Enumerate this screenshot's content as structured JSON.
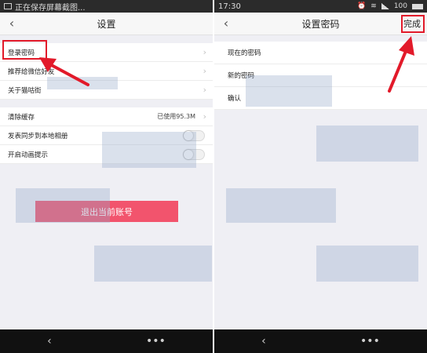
{
  "left_screen": {
    "status": {
      "notice": "正在保存屏幕截图..."
    },
    "title": "设置",
    "rows": [
      {
        "label": "登录密码",
        "value": ""
      },
      {
        "label": "推荐给微信好友",
        "value": ""
      },
      {
        "label": "关于猫咕街",
        "value": ""
      }
    ],
    "rows2": [
      {
        "label": "清除缓存",
        "value": "已使用95.3M"
      },
      {
        "label": "发表同步到本地相册",
        "value": ""
      },
      {
        "label": "开启动画提示",
        "value": ""
      }
    ],
    "logout_label": "退出当前账号",
    "nav": {
      "back": "‹",
      "more": "•••"
    }
  },
  "right_screen": {
    "status": {
      "time": "17:30",
      "battery": "100"
    },
    "title": "设置密码",
    "done_label": "完成",
    "fields": [
      {
        "label": "现在的密码"
      },
      {
        "label": "新的密码"
      },
      {
        "label": "确认"
      }
    ],
    "nav": {
      "back": "‹",
      "more": "•••"
    }
  },
  "colors": {
    "accent": "#f2546d",
    "annotation_red": "#e21a2a",
    "background": "#efeff4"
  }
}
